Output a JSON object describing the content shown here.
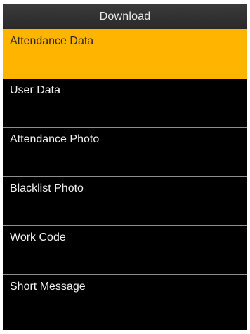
{
  "header": {
    "title": "Download"
  },
  "menu": {
    "selected_index": 0,
    "items": [
      {
        "label": "Attendance Data"
      },
      {
        "label": "User Data"
      },
      {
        "label": "Attendance Photo"
      },
      {
        "label": "Blacklist Photo"
      },
      {
        "label": "Work Code"
      },
      {
        "label": "Short Message"
      }
    ]
  },
  "colors": {
    "selection": "#ffb400",
    "background": "#000000",
    "title_bar": "#333333",
    "text": "#f0f0f0",
    "divider": "#8e8e8e"
  }
}
